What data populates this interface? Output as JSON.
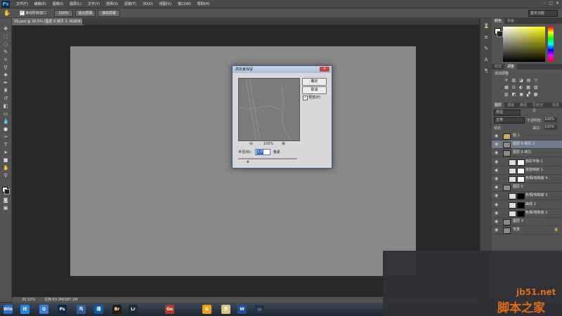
{
  "app": {
    "logo": "Ps"
  },
  "menu": [
    "文件(F)",
    "编辑(E)",
    "图像(I)",
    "图层(L)",
    "文字(Y)",
    "选择(S)",
    "滤镜(T)",
    "3D(D)",
    "视图(V)",
    "窗口(W)",
    "帮助(H)"
  ],
  "window_controls": {
    "minimize": "–",
    "maximize": "□",
    "close": "✕"
  },
  "options_bar": {
    "scroll_all_windows": "滚动所有窗口",
    "zoom_100": "100%",
    "fit_screen": "适合屏幕",
    "fill_screen": "填充屏幕",
    "workspace": "基本功能"
  },
  "document": {
    "tab_title": "29.psd @ 20.5% (图层 6 拷贝 2, RGB/8) *",
    "zoom": "20.52%",
    "doc_info": "文档:63.3M/287.1M"
  },
  "panels": {
    "color_tabs": [
      "颜色",
      "色板"
    ],
    "adjust_tabs": [
      "样式",
      "调整"
    ],
    "add_adjustment": "添加调整",
    "layer_tabs": [
      "图层",
      "通道",
      "路径",
      "历史记录",
      "信息"
    ],
    "kind": "类型",
    "blend_mode": "正常",
    "opacity_label": "不透明度:",
    "opacity": "100%",
    "lock_label": "锁定:",
    "fill_label": "填充:",
    "fill": "100%"
  },
  "layers": [
    {
      "name": "组 1",
      "type": "group",
      "selected": false
    },
    {
      "name": "图层 6 拷贝 2",
      "type": "layer",
      "selected": true
    },
    {
      "name": "图层 6 拷贝",
      "type": "layer",
      "selected": false
    },
    {
      "name": "色彩平衡 1",
      "type": "adj",
      "selected": false
    },
    {
      "name": "渐变映射 1",
      "type": "adj",
      "selected": false
    },
    {
      "name": "色相/饱和度 4",
      "type": "adj",
      "selected": false
    },
    {
      "name": "图层 5",
      "type": "layer",
      "selected": false
    },
    {
      "name": "色相/饱和度 3",
      "type": "adj-dark",
      "selected": false
    },
    {
      "name": "曲线 2",
      "type": "adj-dark",
      "selected": false
    },
    {
      "name": "色相/饱和度 2",
      "type": "adj-dark",
      "selected": false
    },
    {
      "name": "图层 3",
      "type": "layer",
      "selected": false
    },
    {
      "name": "背景",
      "type": "layer",
      "selected": false,
      "locked": true
    }
  ],
  "dialog": {
    "title": "高反差保留",
    "ok": "确定",
    "cancel": "取消",
    "preview_label": "预览(P)",
    "preview_checked": "✓",
    "zoom": "100%",
    "radius_label": "半径(R):",
    "radius_value": "1.0",
    "unit": "像素",
    "close": "✕"
  },
  "watermark": {
    "site": "jb51.net",
    "cn": "脚本之家"
  },
  "taskbar": [
    "Win",
    "IE",
    "Q",
    "Ps",
    "鸟",
    "播",
    "Br",
    "Lr",
    "Go",
    "G",
    "夹",
    "W",
    "▭"
  ],
  "colors": {
    "accent": "#e06d12",
    "selection": "#6f7b8c"
  }
}
